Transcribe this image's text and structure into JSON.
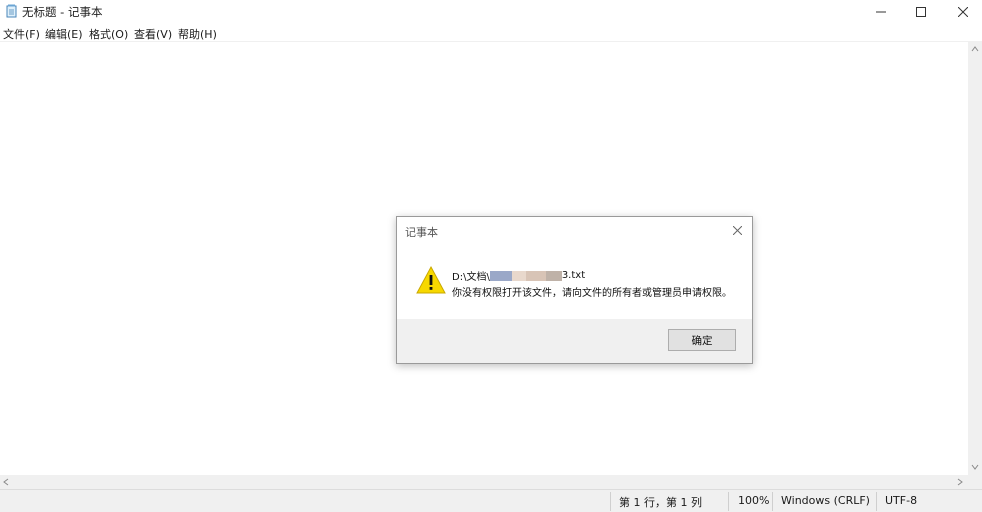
{
  "window": {
    "title": "无标题 - 记事本",
    "app_icon": "notepad-icon"
  },
  "menu": [
    "文件(F)",
    "编辑(E)",
    "格式(O)",
    "查看(V)",
    "帮助(H)"
  ],
  "status": {
    "position": "第 1 行，第 1 列",
    "zoom": "100%",
    "line_ending": "Windows (CRLF)",
    "encoding": "UTF-8"
  },
  "dialog": {
    "title": "记事本",
    "path_prefix": "D:\\文档\\",
    "path_suffix": "3.txt",
    "message": "你没有权限打开该文件，请向文件的所有者或管理员申请权限。",
    "ok_label": "确定",
    "icon": "warning-icon"
  },
  "colors": {
    "warning_yellow": "#f7d800",
    "dialog_footer": "#f0f0f0"
  }
}
